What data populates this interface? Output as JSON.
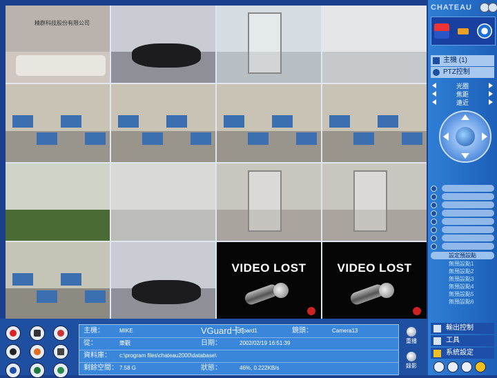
{
  "cameras": [
    {
      "type": "reception",
      "logo": "精群科技股份有限公司",
      "selected": true
    },
    {
      "type": "meeting"
    },
    {
      "type": "glass"
    },
    {
      "type": "lobby"
    },
    {
      "type": "office"
    },
    {
      "type": "office"
    },
    {
      "type": "office"
    },
    {
      "type": "office"
    },
    {
      "type": "outdoor"
    },
    {
      "type": "corridor"
    },
    {
      "type": "door"
    },
    {
      "type": "door"
    },
    {
      "type": "office-empty"
    },
    {
      "type": "meeting"
    },
    {
      "type": "lost",
      "text": "VIDEO LOST"
    },
    {
      "type": "lost",
      "text": "VIDEO LOST"
    }
  ],
  "sidebar": {
    "brand": "CHATEAU",
    "host_menu": "主機 (1)",
    "ptz_menu": "PTZ控制",
    "ptz_controls": [
      "光圈",
      "焦距",
      "遠近"
    ],
    "preset_header": "設定預設點",
    "presets": [
      "無預設點1",
      "無預設點2",
      "無預設點3",
      "無預設點4",
      "無預設點5",
      "無預設點6"
    ],
    "bottom_menu": [
      "輸出控制",
      "工具",
      "系統設定"
    ]
  },
  "info": {
    "host_label": "主機：",
    "host_value": "MIKE",
    "card_label": "VGuard卡：",
    "card_value": "Board1",
    "lens_label": "鏡頭：",
    "lens_value": "Camera13",
    "from_label": "從：",
    "from_value": "樂觀",
    "date_label": "日期：",
    "date_value": "2002/02/19 16:51:39",
    "db_label": "資料庫：",
    "db_value": "c:\\program files\\chateau2000\\database\\",
    "space_label": "剩餘空間：",
    "space_value": "7.58 G",
    "status_label": "狀態：",
    "status_value": "46%, 0.222KB/s",
    "replay_label": "重播",
    "record_label": "錄影"
  }
}
